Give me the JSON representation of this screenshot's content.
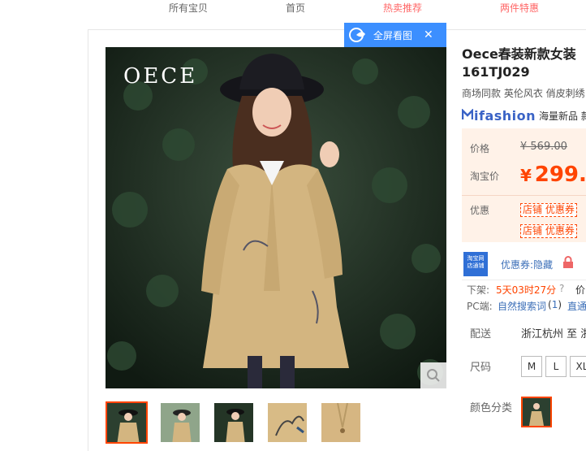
{
  "nav": {
    "items": [
      {
        "label": "所有宝贝",
        "highlight": false
      },
      {
        "label": "首页",
        "highlight": false
      },
      {
        "label": "热卖推荐",
        "highlight": true
      },
      {
        "label": "两件特惠",
        "highlight": true
      }
    ]
  },
  "gallery": {
    "watermark": "OECE",
    "fullscreen_label": "全屏看图",
    "thumbnails": [
      {
        "alt": "thumbnail-1",
        "active": true
      },
      {
        "alt": "thumbnail-2",
        "active": false
      },
      {
        "alt": "thumbnail-3",
        "active": false
      },
      {
        "alt": "thumbnail-4",
        "active": false
      },
      {
        "alt": "thumbnail-5",
        "active": false
      }
    ]
  },
  "product": {
    "title_line1": "Oece春装新款女装",
    "title_line2": "161TJ029",
    "subtitle": "商场同款 英伦风衣 俏皮刺绣",
    "brand_logo": "ifashion",
    "brand_text": "海量新品 款"
  },
  "price": {
    "price_label": "价格",
    "original": "¥ 569.00",
    "taobao_label": "淘宝价",
    "yen": "¥",
    "current": "299.",
    "promo_label": "优惠",
    "coupons": [
      "店铺 优惠券",
      "店铺 优惠券"
    ]
  },
  "tong": {
    "badge": "淘宝网 店通铺",
    "coupon_line": "优惠券:隐藏",
    "expire_label": "下架:",
    "expire_value": "5天03时27分",
    "price_hint": "价",
    "pc_label": "PC端:",
    "pc_search": "自然搜索词",
    "pc_count": "1",
    "pc_direct": "直通"
  },
  "shipping": {
    "label": "配送",
    "value": "浙江杭州 至 浙"
  },
  "sizes": {
    "label": "尺码",
    "options": [
      "M",
      "L",
      "XL"
    ]
  },
  "color": {
    "label": "颜色分类"
  },
  "colors": {
    "accent": "#ff4400",
    "nav_highlight": "#ff6666",
    "blue": "#3c8fff"
  }
}
